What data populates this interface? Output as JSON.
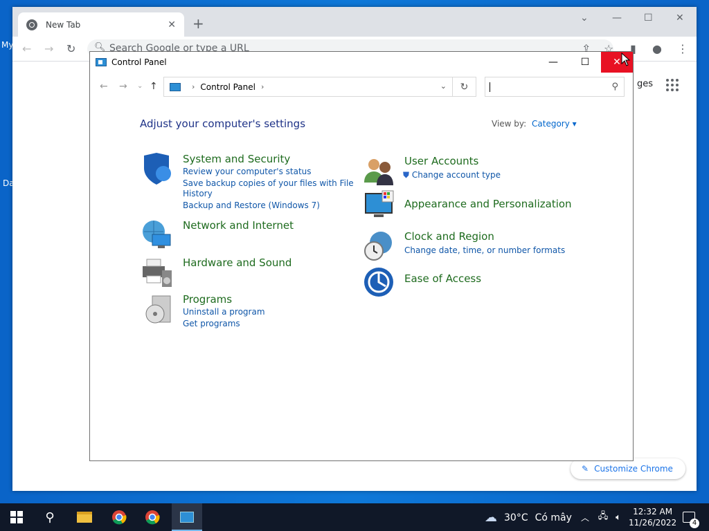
{
  "desktop": {
    "icon1_label": "My",
    "icon2_label": "Da"
  },
  "chrome": {
    "tab_title": "New Tab",
    "omnibox_placeholder": "Search Google or type a URL",
    "images_link": "ges",
    "customize_label": "Customize Chrome"
  },
  "control_panel": {
    "window_title": "Control Panel",
    "breadcrumb": "Control Panel",
    "heading": "Adjust your computer's settings",
    "view_by_label": "View by:",
    "view_by_value": "Category",
    "categories": [
      {
        "title": "System and Security",
        "links": [
          "Review your computer's status",
          "Save backup copies of your files with File",
          "History",
          "Backup and Restore (Windows 7)"
        ]
      },
      {
        "title": "Network and Internet",
        "links": []
      },
      {
        "title": "Hardware and Sound",
        "links": []
      },
      {
        "title": "Programs",
        "links": [
          "Uninstall a program",
          "Get programs"
        ]
      },
      {
        "title": "User Accounts",
        "links": [
          "Change account type"
        ]
      },
      {
        "title": "Appearance and Personalization",
        "links": []
      },
      {
        "title": "Clock and Region",
        "links": [
          "Change date, time, or number formats"
        ]
      },
      {
        "title": "Ease of Access",
        "links": []
      }
    ]
  },
  "taskbar": {
    "temperature": "30°C",
    "weather_text": "Có mây",
    "time": "12:32 AM",
    "date": "11/26/2022",
    "notification_count": "4"
  }
}
